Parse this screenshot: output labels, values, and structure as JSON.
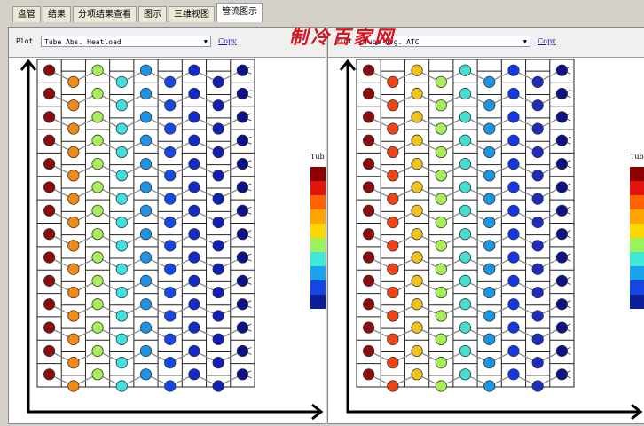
{
  "tabs": [
    {
      "label": "盘管",
      "active": false
    },
    {
      "label": "结果",
      "active": false
    },
    {
      "label": "分项结果查看",
      "active": false
    },
    {
      "label": "图示",
      "active": false
    },
    {
      "label": "三维视图",
      "active": false
    },
    {
      "label": "管流图示",
      "active": true
    }
  ],
  "watermark": "制冷百家网",
  "left_panel": {
    "plot_label": "Plot",
    "plot_value": "Tube Abs. Heatload",
    "copy_label": "Copy",
    "legend_title": "Tub",
    "row_count": 14,
    "column_colors": [
      "#8c0d0d",
      "#f28a13",
      "#a7ee58",
      "#3fe0e0",
      "#1d94e6",
      "#1547ea",
      "#142ac9",
      "#121fb0",
      "#0c1288"
    ]
  },
  "right_panel": {
    "plot_label": "Plot",
    "plot_value": "Tube Avg. ATC",
    "copy_label": "Copy",
    "legend_title": "Tub",
    "row_count": 14,
    "column_colors": [
      "#8c0d0d",
      "#ee4417",
      "#f1c21b",
      "#a7ee58",
      "#42e0d4",
      "#1a96e3",
      "#1338ea",
      "#1c2cc1",
      "#0d1288"
    ]
  },
  "legend_colors": [
    "#8b0000",
    "#e2140b",
    "#ff6200",
    "#ffa500",
    "#ffd700",
    "#9bf25d",
    "#40e8d8",
    "#1ba3ee",
    "#1546e4",
    "#0c1d9a"
  ]
}
